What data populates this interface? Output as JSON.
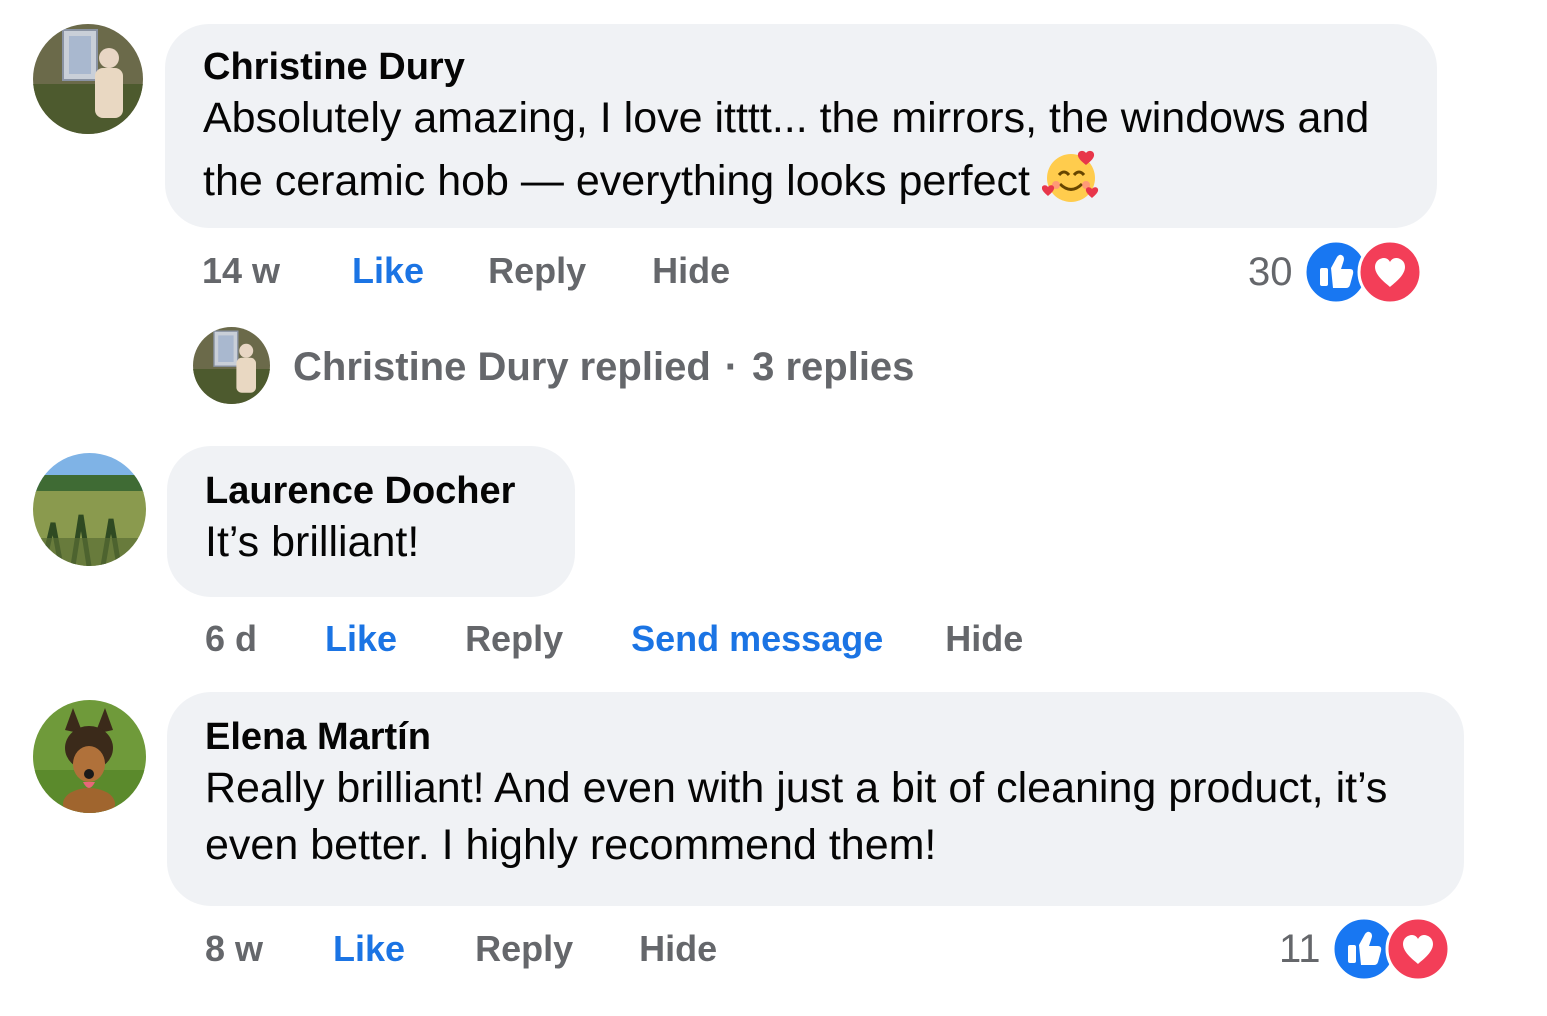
{
  "comments": [
    {
      "author": "Christine Dury",
      "text": "Absolutely amazing, I love itttt... the mirrors, the windows and the ceramic hob — everything looks perfect",
      "emoji": "smiling-face-with-hearts",
      "time": "14 w",
      "like_label": "Like",
      "reply_label": "Reply",
      "hide_label": "Hide",
      "reaction_count": "30",
      "reactions": [
        "like",
        "love"
      ]
    },
    {
      "author": "Laurence Docher",
      "text": "It’s brilliant!",
      "time": "6 d",
      "like_label": "Like",
      "reply_label": "Reply",
      "send_message_label": "Send message",
      "hide_label": "Hide"
    },
    {
      "author": "Elena Martín",
      "text": "Really brilliant! And even with just a bit of cleaning product, it’s even better. I highly recommend them!",
      "time": "8 w",
      "like_label": "Like",
      "reply_label": "Reply",
      "hide_label": "Hide",
      "reaction_count": "11",
      "reactions": [
        "like",
        "love"
      ]
    }
  ],
  "reply_thread": {
    "author": "Christine Dury",
    "replied_label": "replied",
    "separator": "·",
    "replies_count": "3 replies"
  },
  "colors": {
    "bubble": "#f0f2f5",
    "link_blue": "#1b74e4",
    "meta_grey": "#65676b",
    "like_blue": "#1877f2",
    "love_red": "#f33e58"
  }
}
